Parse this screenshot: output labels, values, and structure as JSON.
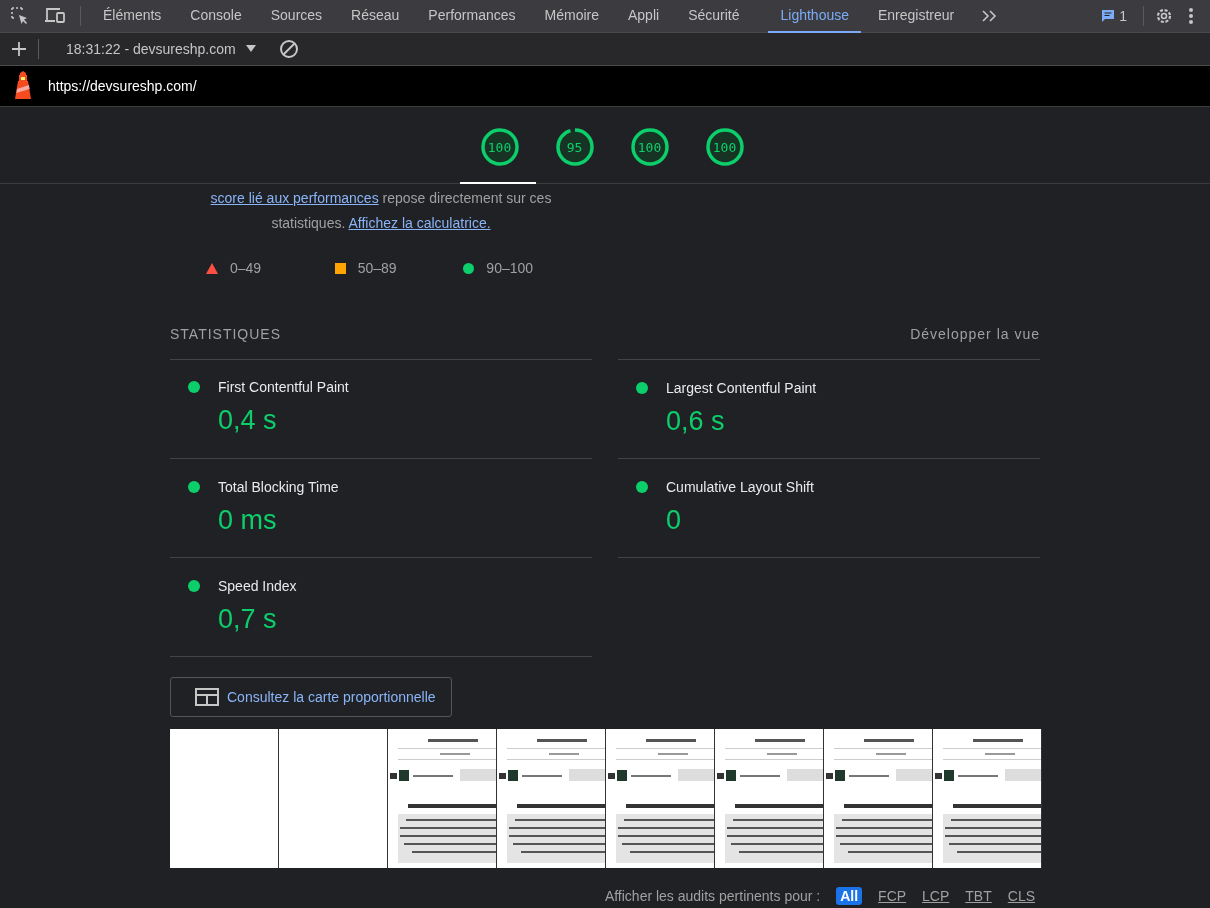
{
  "tabs": [
    {
      "label": "Éléments",
      "selected": false
    },
    {
      "label": "Console",
      "selected": false
    },
    {
      "label": "Sources",
      "selected": false
    },
    {
      "label": "Réseau",
      "selected": false
    },
    {
      "label": "Performances",
      "selected": false
    },
    {
      "label": "Mémoire",
      "selected": false
    },
    {
      "label": "Appli",
      "selected": false
    },
    {
      "label": "Sécurité",
      "selected": false
    },
    {
      "label": "Lighthouse",
      "selected": true
    },
    {
      "label": "Enregistreur",
      "selected": false
    }
  ],
  "issues_count": "1",
  "report_selector": "18:31:22 - devsureshp.com",
  "url": "https://devsureshp.com/",
  "gauges": [
    {
      "score": "100",
      "level": 1
    },
    {
      "score": "95",
      "level": 0.95
    },
    {
      "score": "100",
      "level": 1
    },
    {
      "score": "100",
      "level": 1
    }
  ],
  "description": [
    {
      "text": "score lié aux performances",
      "link": true
    },
    {
      "text": " repose directement sur ces statistiques. ",
      "link": false
    },
    {
      "text": "Affichez la calculatrice.",
      "link": true
    }
  ],
  "legend": [
    {
      "kind": "fail",
      "label": "0–49"
    },
    {
      "kind": "average",
      "label": "50–89"
    },
    {
      "kind": "pass",
      "label": "90–100"
    }
  ],
  "metrics_title": "STATISTIQUES",
  "expand_toggle": "Développer la vue",
  "metrics": [
    {
      "name": "First Contentful Paint",
      "value": "0,4 s",
      "kind": "pass"
    },
    {
      "name": "Largest Contentful Paint",
      "value": "0,6 s",
      "kind": "pass"
    },
    {
      "name": "Total Blocking Time",
      "value": "0 ms",
      "kind": "pass"
    },
    {
      "name": "Cumulative Layout Shift",
      "value": "0",
      "kind": "pass"
    },
    {
      "name": "Speed Index",
      "value": "0,7 s",
      "kind": "pass"
    }
  ],
  "treemap_button": "Consultez la carte proportionnelle",
  "filmstrip": [
    {
      "kind": "blank"
    },
    {
      "kind": "blank"
    },
    {
      "kind": "picture"
    },
    {
      "kind": "picture"
    },
    {
      "kind": "picture"
    },
    {
      "kind": "picture"
    },
    {
      "kind": "picture"
    },
    {
      "kind": "picture"
    }
  ],
  "audit_filter": {
    "label": "Afficher les audits pertinents pour :",
    "options": [
      {
        "label": "All",
        "selected": true
      },
      {
        "label": "FCP",
        "selected": false
      },
      {
        "label": "LCP",
        "selected": false
      },
      {
        "label": "TBT",
        "selected": false
      },
      {
        "label": "CLS",
        "selected": false
      }
    ]
  }
}
